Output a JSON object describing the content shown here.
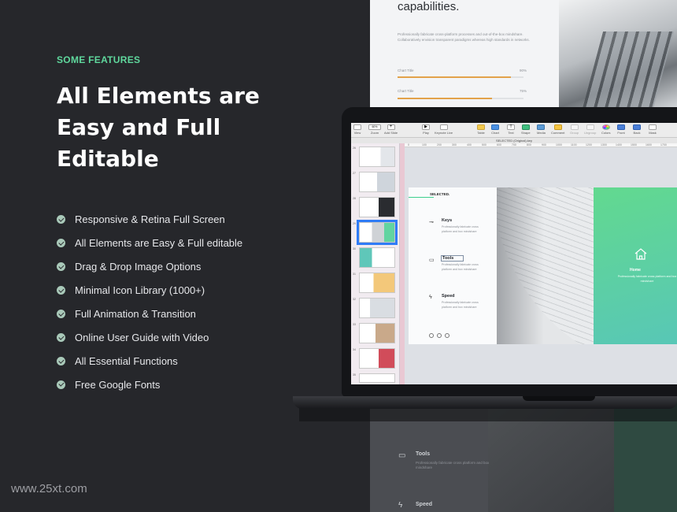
{
  "promo": {
    "kicker": "SOME FEATURES",
    "headline_lines": [
      "All Elements are",
      "Easy and Full",
      "Editable"
    ],
    "features": [
      "Responsive & Retina Full Screen",
      "All Elements are Easy & Full editable",
      "Drag & Drop Image Options",
      "Minimal Icon Library (1000+)",
      "Full Animation & Transition",
      "Online User Guide with Video",
      "All Essential Functions",
      "Free Google Fonts"
    ],
    "watermark": "www.25xt.com"
  },
  "background_slide": {
    "heading": "capabilities.",
    "description": "Professionally fabricate cross-platform processes and out-of-the-box mindshare. Collaboratively envision transparent paradigms whereas high standards in networks.",
    "charts": [
      {
        "label": "Chart Title",
        "value": "90%",
        "fraction": 0.9
      },
      {
        "label": "Chart Title",
        "value": "75%",
        "fraction": 0.75
      }
    ],
    "tool_label": "Tools",
    "tool_desc": "Professionally fabricate cross platform and box mindshare",
    "speed_label": "Speed"
  },
  "app": {
    "toolbar": {
      "left": [
        {
          "label": "View",
          "icon": "sidebar-icon"
        },
        {
          "label": "Zoom",
          "value": "60%",
          "icon": "zoom-icon"
        },
        {
          "label": "Add Slide",
          "icon": "plus-icon"
        }
      ],
      "center": [
        {
          "label": "Play",
          "icon": "play-icon"
        },
        {
          "label": "Keynote Live",
          "icon": "keynote-live-icon"
        }
      ],
      "right": [
        {
          "label": "Table",
          "icon": "table-icon"
        },
        {
          "label": "Chart",
          "icon": "chart-icon"
        },
        {
          "label": "Text",
          "icon": "text-icon"
        },
        {
          "label": "Shape",
          "icon": "shape-icon"
        },
        {
          "label": "Media",
          "icon": "media-icon"
        },
        {
          "label": "Comment",
          "icon": "comment-icon"
        },
        {
          "label": "Group",
          "icon": "group-icon"
        },
        {
          "label": "Ungroup",
          "icon": "ungroup-icon"
        },
        {
          "label": "Colors",
          "icon": "colors-icon"
        },
        {
          "label": "Front",
          "icon": "front-icon"
        },
        {
          "label": "Back",
          "icon": "back-icon"
        },
        {
          "label": "Mask",
          "icon": "mask-icon"
        }
      ]
    },
    "document_title": "SELECTED (Original).key",
    "ruler_marks": [
      "0",
      "100",
      "200",
      "300",
      "400",
      "500",
      "600",
      "700",
      "800",
      "900",
      "1000",
      "1100",
      "1200",
      "1300",
      "1400",
      "1500",
      "1600",
      "1700"
    ],
    "thumbnails": [
      "26",
      "27",
      "28",
      "29",
      "30",
      "31",
      "32",
      "33",
      "34",
      "35",
      "36"
    ],
    "selected_thumbnail": "30",
    "slide": {
      "brand": "SELECTED.",
      "items": [
        {
          "title": "Keys",
          "desc": "Professionally fabricate cross platform and box mindshare",
          "icon": "key-icon"
        },
        {
          "title": "Tools",
          "desc": "Professionally fabricate cross platform and box mindshare",
          "icon": "laptop-icon"
        },
        {
          "title": "Speed",
          "desc": "Professionally fabricate cross platform and box mindshare",
          "icon": "lightning-icon"
        }
      ],
      "home_title": "Home",
      "home_desc": "Professionally fabricate cross platform and box mindshare"
    }
  },
  "colors": {
    "accent_green": "#5fd89d",
    "background": "#26272b",
    "selection_blue": "#2f7cf6"
  }
}
